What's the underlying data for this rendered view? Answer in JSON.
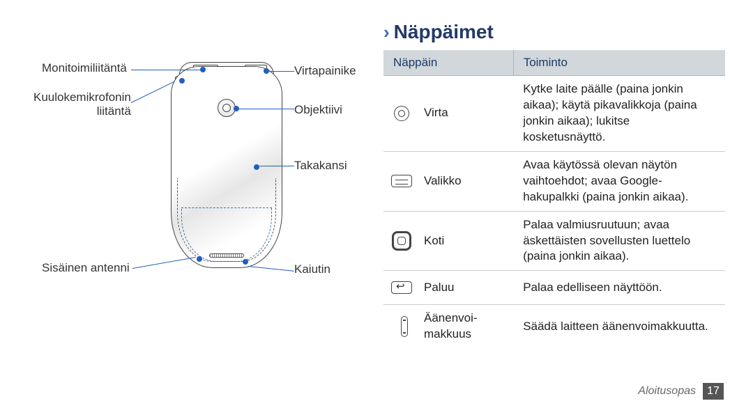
{
  "heading": "Näppäimet",
  "diagram": {
    "labels_left": {
      "multi": "Monitoimiliitäntä",
      "headset_l1": "Kuulokemikrofonin",
      "headset_l2": "liitäntä",
      "antenna": "Sisäinen antenni"
    },
    "labels_right": {
      "power": "Virtapainike",
      "lens": "Objektiivi",
      "backcover": "Takakansi",
      "speaker": "Kaiutin"
    }
  },
  "table": {
    "head": {
      "col1": "Näppäin",
      "col2": "Toiminto"
    },
    "rows": [
      {
        "key": "Virta",
        "func": "Kytke laite päälle (paina jonkin aikaa); käytä pikavalikkoja (paina jonkin aikaa); lukitse kosketusnäyttö."
      },
      {
        "key": "Valikko",
        "func": "Avaa käytössä olevan näytön vaihtoehdot; avaa Google-hakupalkki (paina jonkin aikaa)."
      },
      {
        "key": "Koti",
        "func": "Palaa valmiusruutuun; avaa äskettäisten sovellusten luettelo (paina jonkin aikaa)."
      },
      {
        "key": "Paluu",
        "func": "Palaa edelliseen näyttöön."
      },
      {
        "key": "Äänenvoi-\nmakkuus",
        "func": "Säädä laitteen äänenvoimakkuutta."
      }
    ]
  },
  "footer": {
    "section": "Aloitusopas",
    "page": "17"
  }
}
